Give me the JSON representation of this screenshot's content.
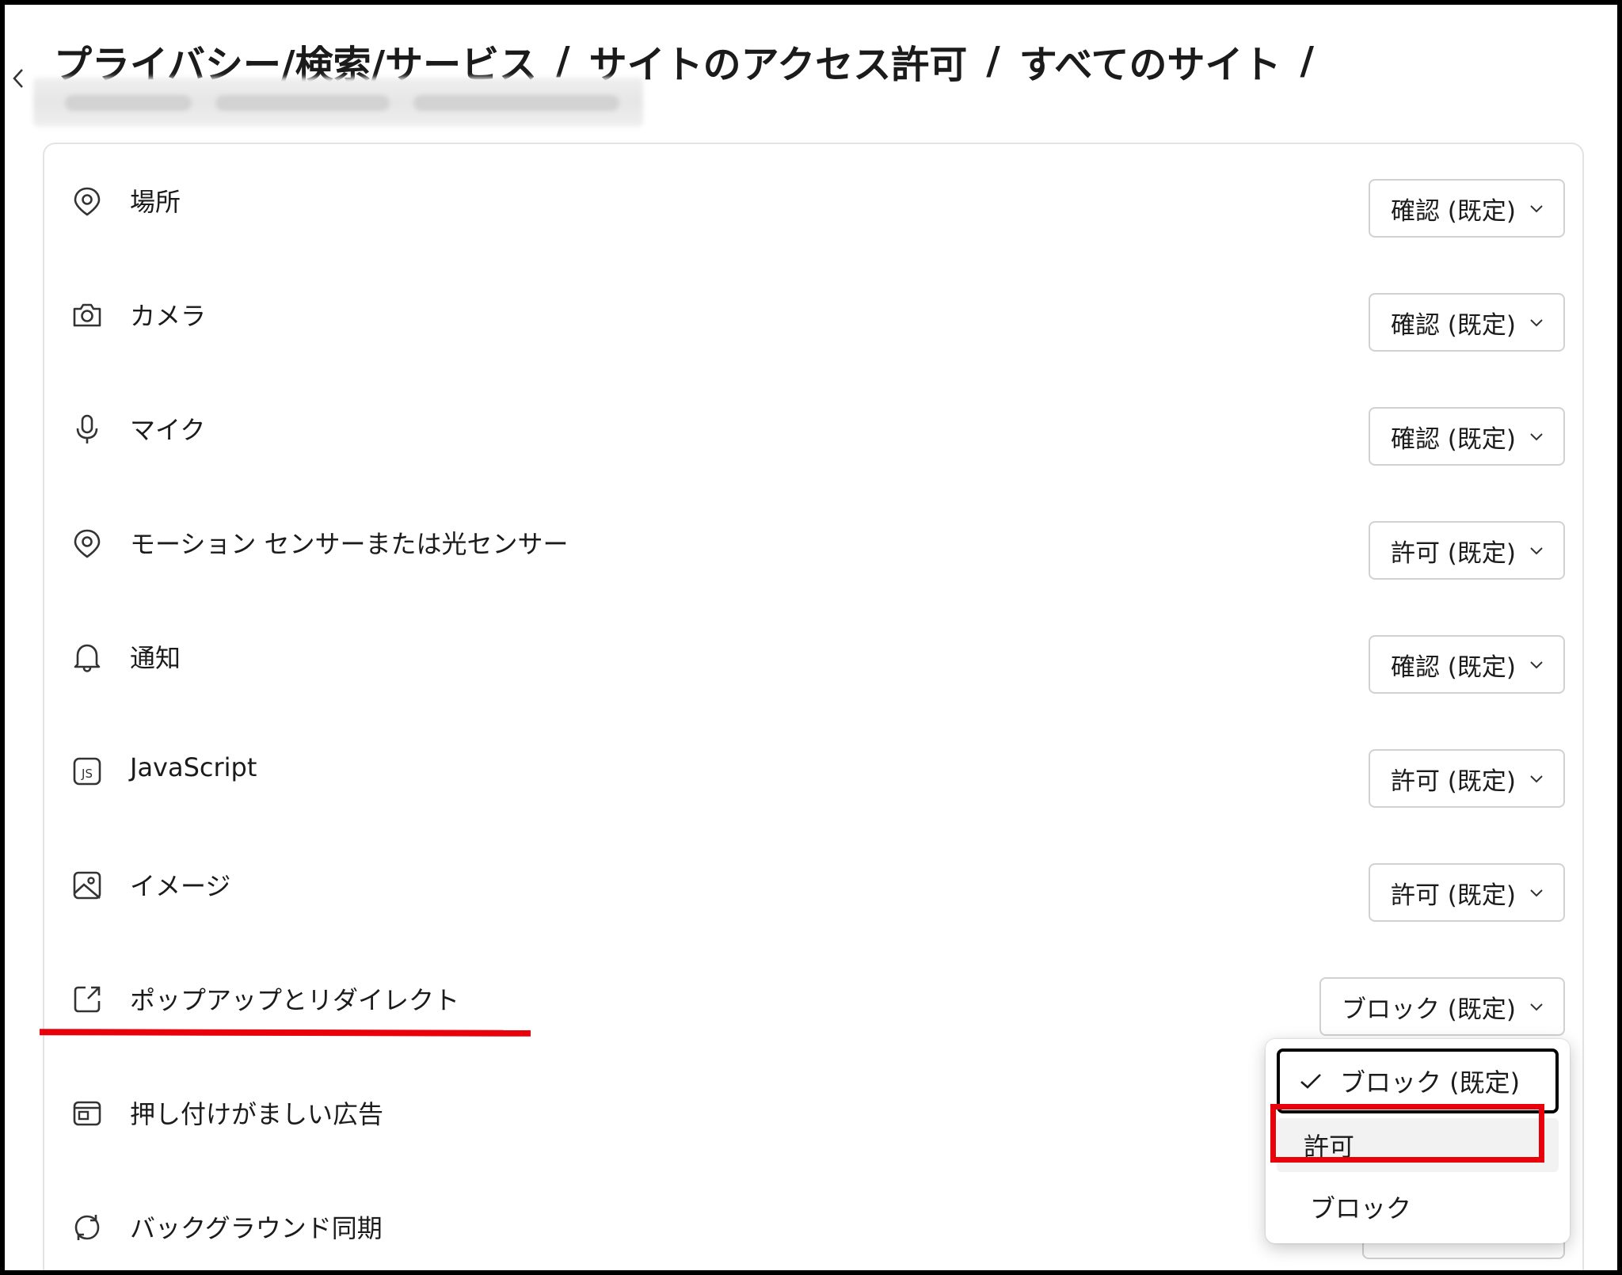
{
  "breadcrumb": {
    "items": [
      "プライバシー/検索/サービス",
      "サイトのアクセス許可",
      "すべてのサイト"
    ],
    "separator": "/"
  },
  "permissions": [
    {
      "label": "場所",
      "icon": "location-pin-icon",
      "value": "確認 (既定)"
    },
    {
      "label": "カメラ",
      "icon": "camera-icon",
      "value": "確認 (既定)"
    },
    {
      "label": "マイク",
      "icon": "microphone-icon",
      "value": "確認 (既定)"
    },
    {
      "label": "モーション センサーまたは光センサー",
      "icon": "motion-sensor-icon",
      "value": "許可 (既定)"
    },
    {
      "label": "通知",
      "icon": "bell-icon",
      "value": "確認 (既定)"
    },
    {
      "label": "JavaScript",
      "icon": "javascript-icon",
      "value": "許可 (既定)"
    },
    {
      "label": "イメージ",
      "icon": "image-icon",
      "value": "許可 (既定)"
    },
    {
      "label": "ポップアップとリダイレクト",
      "icon": "external-link-icon",
      "value": "ブロック (既定)"
    },
    {
      "label": "押し付けがましい広告",
      "icon": "ad-window-icon",
      "value": ""
    },
    {
      "label": "バックグラウンド同期",
      "icon": "sync-icon",
      "value": ""
    }
  ],
  "dropdown": {
    "options": [
      "ブロック (既定)",
      "許可",
      "ブロック"
    ],
    "selected_index": 0
  },
  "colors": {
    "highlight_red": "#e8000b",
    "text": "#1b1b1b",
    "border": "#d1d1d1"
  }
}
